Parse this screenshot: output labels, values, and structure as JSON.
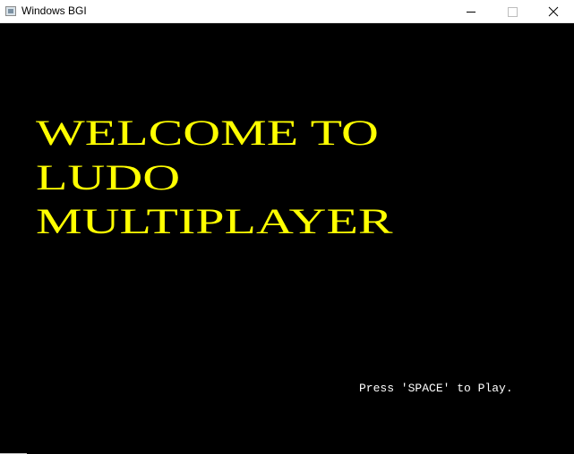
{
  "window": {
    "title": "Windows BGI",
    "icon": "app-window-icon",
    "controls": [
      "minimize-icon",
      "maximize-icon",
      "close-icon"
    ]
  },
  "screen": {
    "welcome_lines": [
      "WELCOME TO",
      "LUDO",
      "MULTIPLAYER"
    ],
    "prompt": "Press 'SPACE' to Play."
  },
  "colors": {
    "background": "#000000",
    "welcome_text": "#ffff00",
    "prompt_text": "#ffffff",
    "titlebar": "#ffffff"
  }
}
